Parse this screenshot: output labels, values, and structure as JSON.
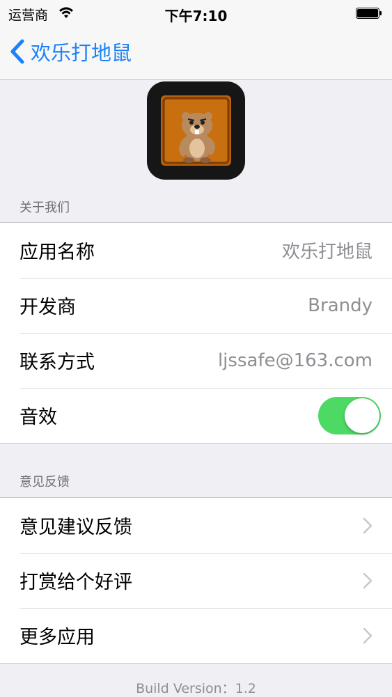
{
  "status_bar": {
    "carrier": "运营商",
    "time": "下午7:10"
  },
  "nav": {
    "back_label": "欢乐打地鼠"
  },
  "app_icon": {
    "description_icon": "beaver-mascot-icon"
  },
  "about": {
    "header": "关于我们",
    "rows": [
      {
        "label": "应用名称",
        "value": "欢乐打地鼠"
      },
      {
        "label": "开发商",
        "value": "Brandy"
      },
      {
        "label": "联系方式",
        "value": "ljssafe@163.com"
      }
    ],
    "sound": {
      "label": "音效",
      "on": true
    }
  },
  "feedback": {
    "header": "意见反馈",
    "rows": [
      {
        "label": "意见建议反馈"
      },
      {
        "label": "打赏给个好评"
      },
      {
        "label": "更多应用"
      }
    ]
  },
  "footer": {
    "build_version": "Build Version：1.2"
  },
  "colors": {
    "accent": "#1a82fb",
    "toggle_on": "#4cd964",
    "background": "#efeff4"
  }
}
